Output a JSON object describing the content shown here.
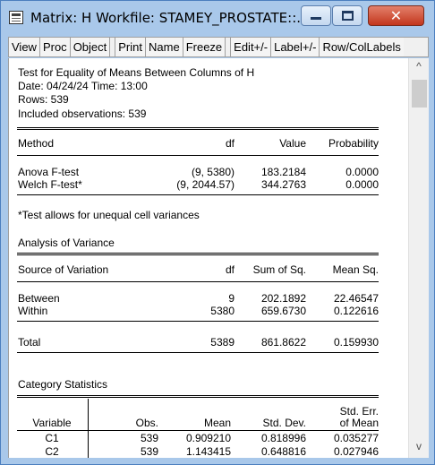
{
  "window": {
    "title": "Matrix: H   Workfile: STAMEY_PROSTATE::...",
    "close_glyph": "✕"
  },
  "toolbar": [
    "View",
    "Proc",
    "Object",
    "Print",
    "Name",
    "Freeze",
    "Edit+/-",
    "Label+/-",
    "Row/ColLabels"
  ],
  "header": {
    "test_title": "Test for Equality of Means Between Columns of H",
    "date_line": "Date: 04/24/24   Time: 13:00",
    "rows_line": "Rows: 539",
    "obs_line": "Included observations: 539"
  },
  "method_table": {
    "headers": [
      "Method",
      "df",
      "Value",
      "Probability"
    ],
    "rows": [
      [
        "Anova F-test",
        "(9, 5380)",
        "183.2184",
        "0.0000"
      ],
      [
        "Welch F-test*",
        "(9, 2044.57)",
        "344.2763",
        "0.0000"
      ]
    ],
    "note": "*Test allows for unequal cell variances"
  },
  "anova": {
    "title": "Analysis of Variance",
    "headers": [
      "Source of Variation",
      "df",
      "Sum of Sq.",
      "Mean Sq."
    ],
    "rows": [
      [
        "Between",
        "9",
        "202.1892",
        "22.46547"
      ],
      [
        "Within",
        "5380",
        "659.6730",
        "0.122616"
      ]
    ],
    "total": [
      "Total",
      "5389",
      "861.8622",
      "0.159930"
    ]
  },
  "category": {
    "title": "Category Statistics",
    "header_top": "Std. Err.",
    "headers": [
      "Variable",
      "Obs.",
      "Mean",
      "Std. Dev.",
      "of Mean"
    ],
    "rows": [
      [
        "C1",
        "539",
        "0.909210",
        "0.818996",
        "0.035277"
      ],
      [
        "C2",
        "539",
        "1.143415",
        "0.648816",
        "0.027946"
      ]
    ]
  },
  "scrollbar": {
    "up_glyph": "^",
    "down_glyph": "v"
  }
}
